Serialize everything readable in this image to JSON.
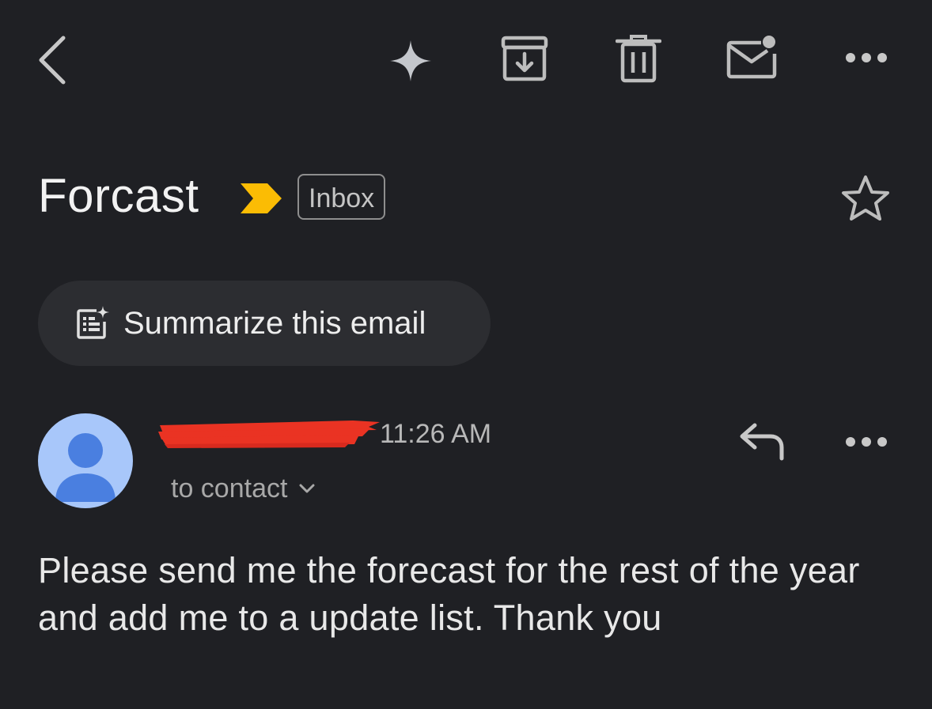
{
  "toolbar": {
    "back_icon": "chevron-left-icon",
    "ai_icon": "sparkle-icon",
    "archive_icon": "archive-icon",
    "delete_icon": "trash-icon",
    "unread_icon": "mark-unread-mail-icon",
    "more_icon": "more-horizontal-icon"
  },
  "email": {
    "subject": "Forcast",
    "important_icon": "importance-marker-icon",
    "importance_color": "#fbbc04",
    "label": "Inbox",
    "star_icon": "star-outline-icon"
  },
  "summarize": {
    "icon": "summarize-doc-sparkle-icon",
    "label": "Summarize this email"
  },
  "message": {
    "avatar_icon": "default-person-avatar",
    "avatar_bg": "#a8c7fa",
    "avatar_fg": "#4a7fe0",
    "sender_redacted": true,
    "redaction_color": "#ea3323",
    "time": "11:26 AM",
    "recipient": "to contact",
    "recipient_chevron": "chevron-down-icon",
    "reply_icon": "reply-icon",
    "more_icon": "more-horizontal-icon",
    "body": "Please send me the forecast for the rest of the year and add me to a update list. Thank you"
  }
}
